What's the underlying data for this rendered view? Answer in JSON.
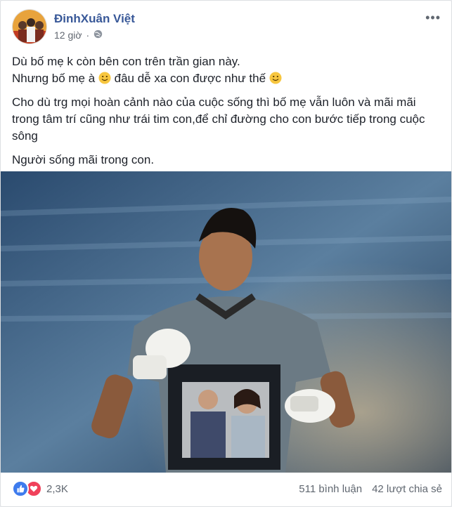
{
  "post": {
    "author": "ĐinhXuân Việt",
    "time": "12 giờ",
    "privacy_icon": "globe-icon",
    "more_icon": "more-options-icon"
  },
  "content": {
    "line1": "Dù bố mẹ k còn bên con trên trần gian này.",
    "line2a": "Nhưng bố mẹ à",
    "line2b": "đâu dễ xa con được như thế",
    "para2": "Cho dù trg mọi hoàn cảnh nào của cuộc sống thì bố mẹ vẫn luôn và mãi mãi trong tâm trí cũng như trái tim con,để chỉ đường cho con bước tiếp trong cuộc sông",
    "para3": "Người sống mãi trong con."
  },
  "footer": {
    "reactions": "2,3K",
    "comments": "511 bình luận",
    "shares": "42 lượt chia sẻ"
  },
  "colors": {
    "author": "#385898",
    "like": "#3d7bed",
    "love": "#f0415b"
  }
}
